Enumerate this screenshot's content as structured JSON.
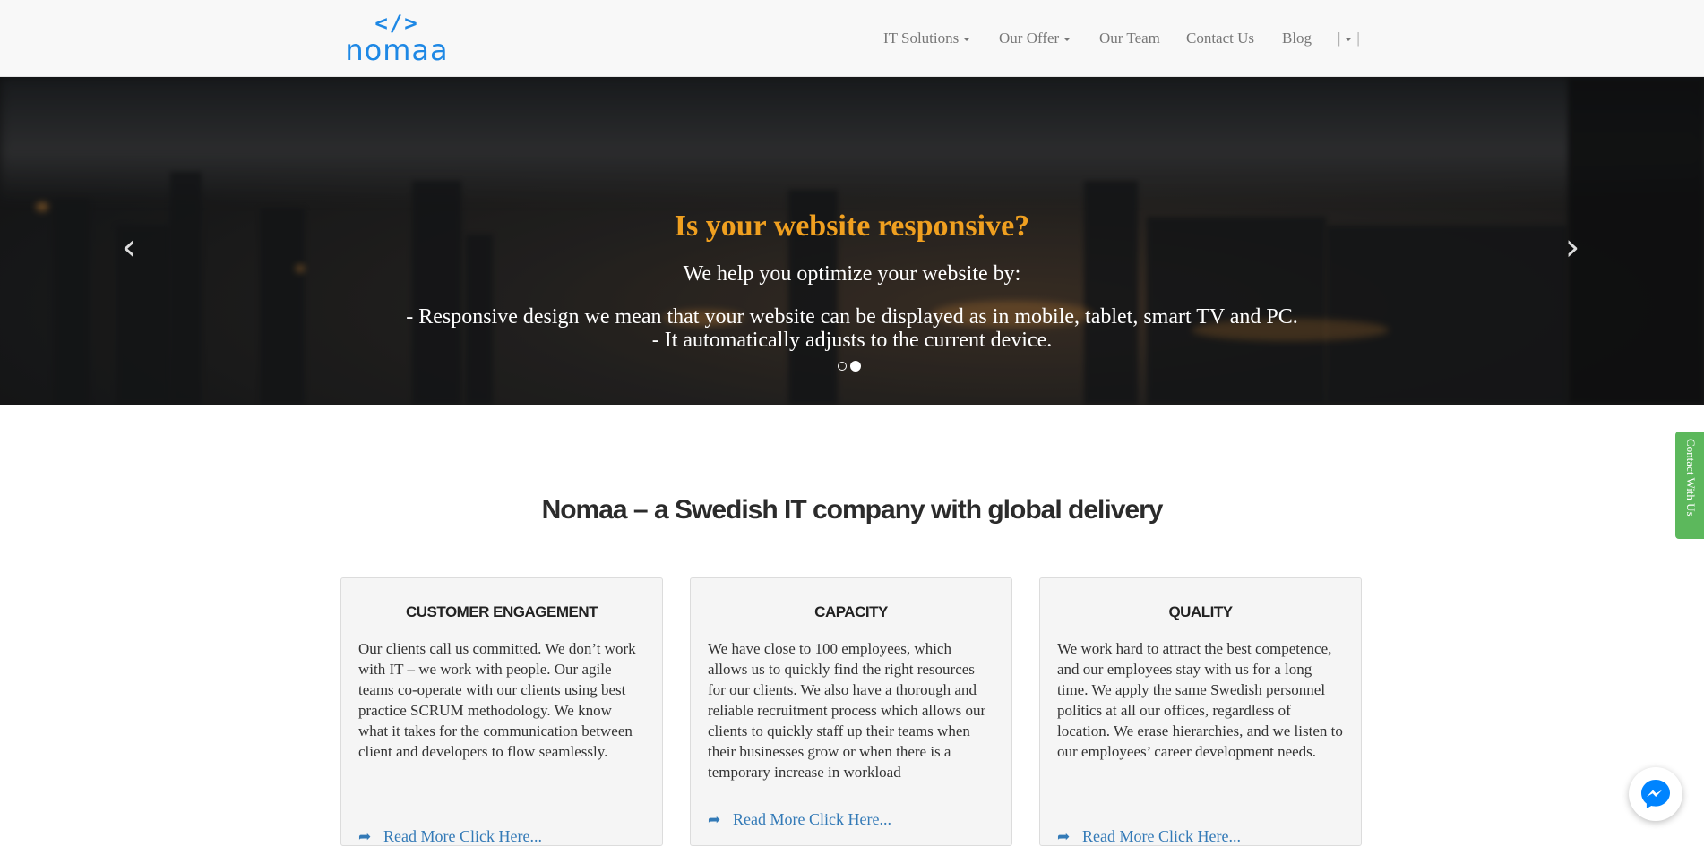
{
  "logo": {
    "code_text": "</>",
    "word": "nomaa"
  },
  "nav": {
    "items": [
      {
        "label": "IT Solutions",
        "dropdown": true
      },
      {
        "label": "Our Offer",
        "dropdown": true
      },
      {
        "label": "Our Team",
        "dropdown": false
      },
      {
        "label": "Contact Us",
        "dropdown": false
      },
      {
        "label": "Blog",
        "dropdown": false
      }
    ],
    "lang_left": "|",
    "lang_right": "|"
  },
  "hero": {
    "title": "Is your website responsive?",
    "subtitle": "We help you optimize your website by:",
    "line1": "- Responsive design we mean that your website can be displayed as in mobile, tablet, smart TV and PC.",
    "line2": "- It automatically adjusts to the current device.",
    "prev_icon": "chevron-left-icon",
    "next_icon": "chevron-right-icon",
    "slides": 2,
    "active_slide": 2
  },
  "section": {
    "title": "Nomaa – a Swedish IT company with global delivery"
  },
  "cards": [
    {
      "title": "CUSTOMER ENGAGEMENT",
      "text": "Our clients call us committed. We don’t work with IT – we work with people. Our agile teams co-operate with our clients using best practice SCRUM methodology. We know what it takes for the communication between client and developers to flow seamlessly.",
      "link": "Read More Click Here..."
    },
    {
      "title": "CAPACITY",
      "text": "We have close to 100 employees, which allows us to quickly find the right resources for our clients. We also have a thorough and reliable recruitment process which allows our clients to quickly staff up their teams when their businesses grow or when there is a temporary increase in workload",
      "link": "Read More Click Here..."
    },
    {
      "title": "QUALITY",
      "text": "We work hard to attract the best competence, and our employees stay with us for a long time. We apply the same Swedish personnel politics at all our offices, regardless of location. We erase hierarchies, and we listen to our employees’ career development needs.",
      "link": "Read More Click Here..."
    }
  ],
  "contact_tab": {
    "label": "Contact With Us",
    "color": "#5cb85c"
  },
  "messenger": {
    "icon": "messenger-icon",
    "color": "#0084ff"
  },
  "colors": {
    "accent": "#f0a020",
    "link": "#337ab7",
    "logo": "#1e88e5"
  }
}
